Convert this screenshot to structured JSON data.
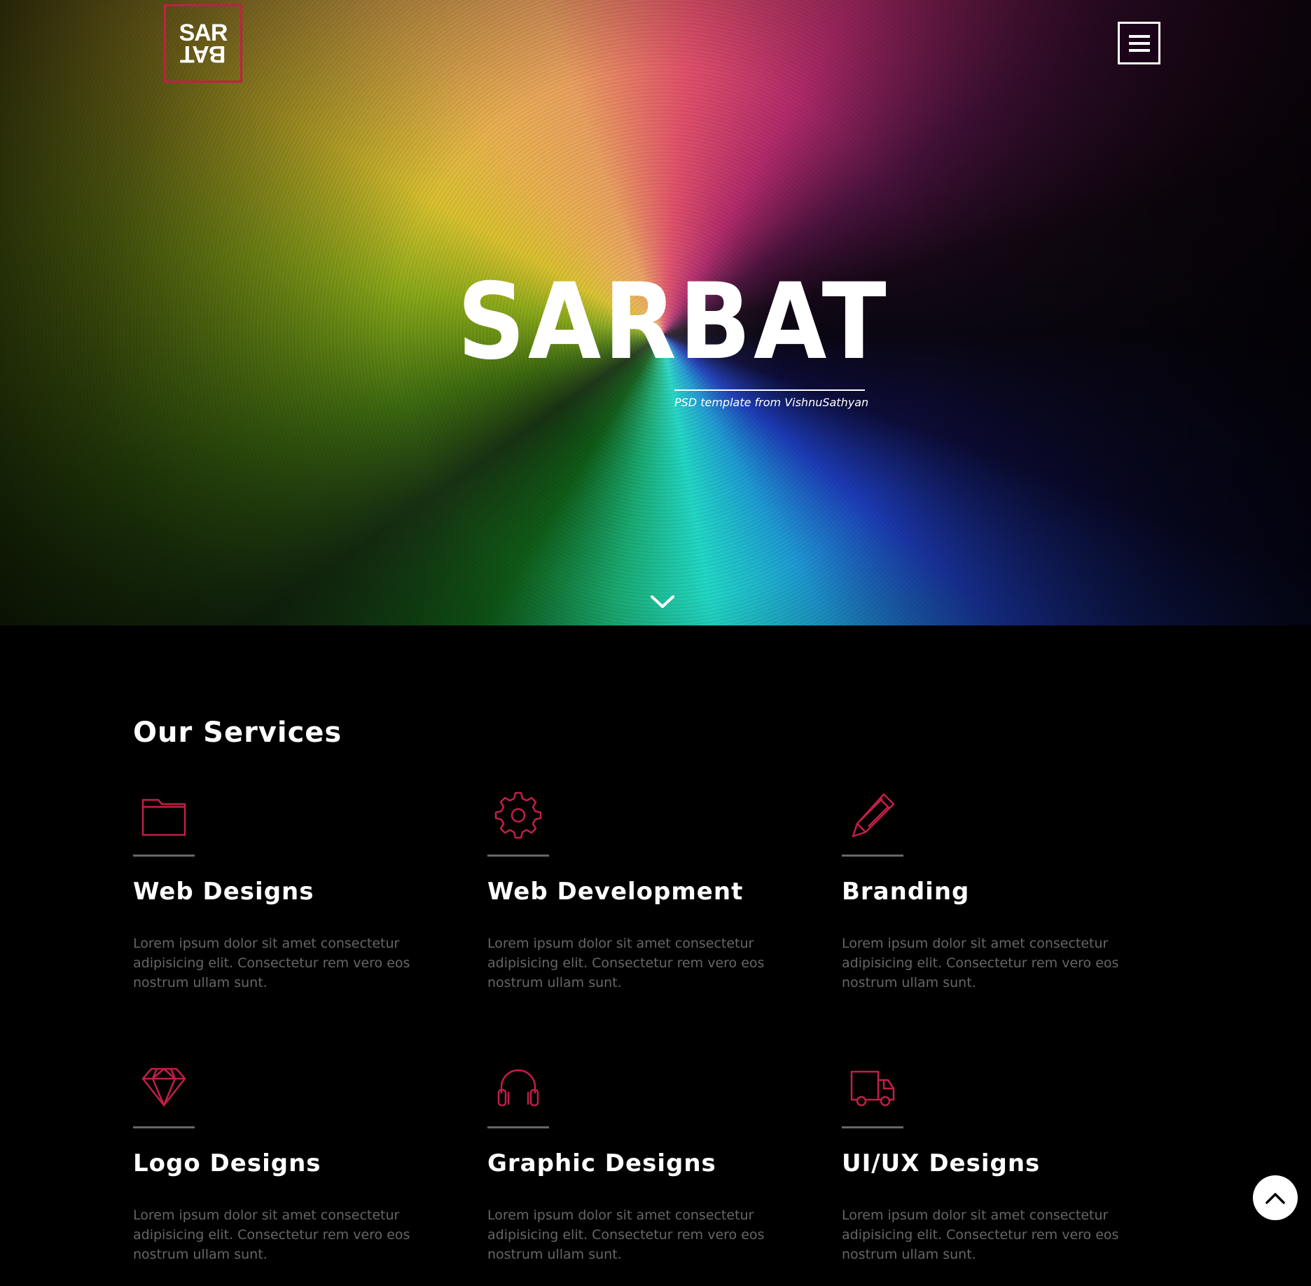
{
  "header": {
    "logo_top": "SAR",
    "logo_bottom": "BAT",
    "menu_icon": "hamburger-menu-icon"
  },
  "hero": {
    "title": "SARBAT",
    "tagline": "PSD template from VishnuSathyan",
    "scroll_icon": "chevron-down-icon"
  },
  "services": {
    "heading": "Our Services",
    "items": [
      {
        "icon": "folder-icon",
        "title": "Web Designs",
        "description": "Lorem ipsum dolor sit amet consectetur adipisicing elit. Consectetur rem vero eos nostrum ullam sunt."
      },
      {
        "icon": "gear-icon",
        "title": "Web Development",
        "description": "Lorem ipsum dolor sit amet consectetur adipisicing elit. Consectetur rem vero eos nostrum ullam sunt."
      },
      {
        "icon": "pencil-icon",
        "title": "Branding",
        "description": "Lorem ipsum dolor sit amet consectetur adipisicing elit. Consectetur rem vero eos nostrum ullam sunt."
      },
      {
        "icon": "diamond-icon",
        "title": "Logo Designs",
        "description": "Lorem ipsum dolor sit amet consectetur adipisicing elit. Consectetur rem vero eos nostrum ullam sunt."
      },
      {
        "icon": "headphones-icon",
        "title": "Graphic Designs",
        "description": "Lorem ipsum dolor sit amet consectetur adipisicing elit. Consectetur rem vero eos nostrum ullam sunt."
      },
      {
        "icon": "truck-icon",
        "title": "UI/UX Designs",
        "description": "Lorem ipsum dolor sit amet consectetur adipisicing elit. Consectetur rem vero eos nostrum ullam sunt."
      }
    ]
  },
  "back_to_top_icon": "chevron-up-icon",
  "colors": {
    "accent": "#c21f47",
    "background": "#000000",
    "muted_text": "#666666"
  }
}
